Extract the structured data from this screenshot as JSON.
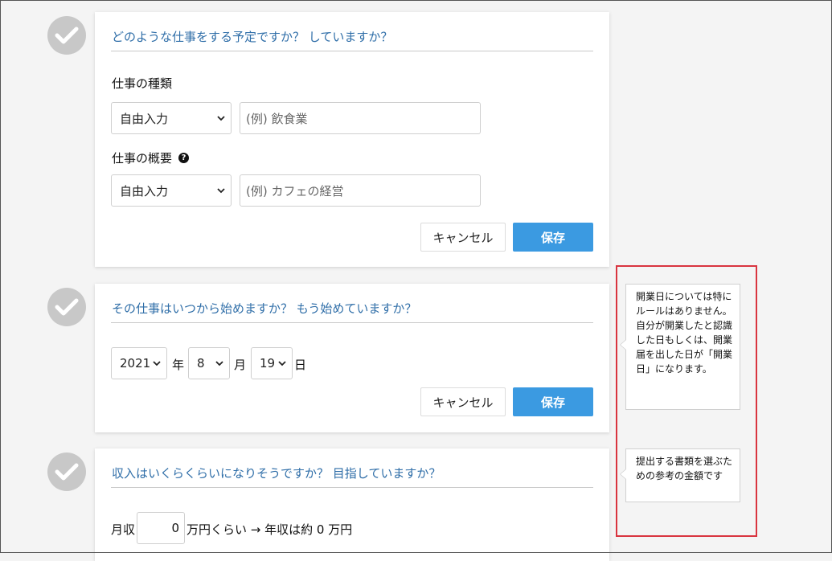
{
  "section_type": {
    "question": "どのような仕事をする予定ですか？ していますか？",
    "type_label": "仕事の種類",
    "type_select": "自由入力",
    "type_placeholder": "(例) 飲食業",
    "summary_label": "仕事の概要",
    "help_glyph": "?",
    "summary_select": "自由入力",
    "summary_placeholder": "(例) カフェの経営",
    "cancel_label": "キャンセル",
    "save_label": "保存"
  },
  "section_start": {
    "question": "その仕事はいつから始めますか？ もう始めていますか？",
    "year_value": "2021",
    "year_unit": "年",
    "month_value": "8",
    "month_unit": "月",
    "day_value": "19",
    "day_unit": "日",
    "cancel_label": "キャンセル",
    "save_label": "保存"
  },
  "section_income": {
    "question": "収入はいくらくらいになりそうですか？ 目指していますか？",
    "monthly_prefix": "月収",
    "monthly_value": "0",
    "monthly_suffix": "万円くらい → 年収は約",
    "annual_value": "0",
    "annual_unit": "万円"
  },
  "tooltips": {
    "start_date": "開業日については特にルールはありません。自分が開業したと認識した日もしくは、開業届を出した日が「開業日」になります。",
    "income": "提出する書類を選ぶための参考の金額です"
  },
  "colors": {
    "accent": "#3b9ae1",
    "title_text": "#2f6ea8",
    "highlight_border": "#d9343f",
    "check_bg": "#c8c8c8"
  }
}
